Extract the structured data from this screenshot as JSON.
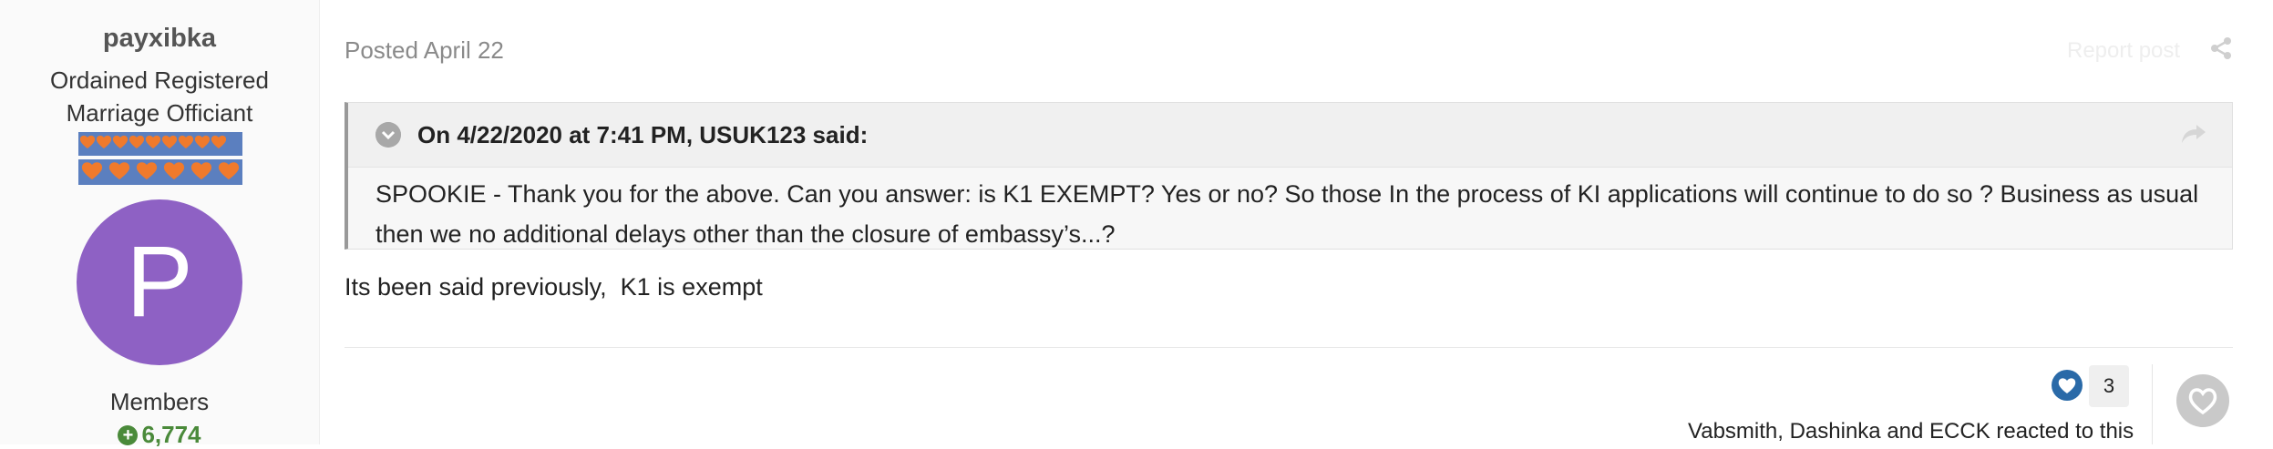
{
  "author": {
    "name": "payxibka",
    "title_line1": "Ordained Registered",
    "title_line2": "Marriage Officiant",
    "avatar_letter": "P",
    "avatar_color": "#8e61c4",
    "group": "Members",
    "reputation": "6,774"
  },
  "post": {
    "posted": "Posted April 22",
    "report_label": "Report post",
    "quote": {
      "citation": "On 4/22/2020 at 7:41 PM, USUK123 said:",
      "body": "SPOOKIE - Thank you for the above. Can you answer: is K1 EXEMPT? Yes or no? So those In the process of KI applications will continue to do so ? Business as usual then we no additional delays other than the closure of embassy’s...?"
    },
    "text": "Its been said previously,  K1 is exempt"
  },
  "reactions": {
    "count": "3",
    "reacted_by": "Vabsmith, Dashinka and ECCK reacted to this",
    "like_color": "#2a6aa8"
  }
}
